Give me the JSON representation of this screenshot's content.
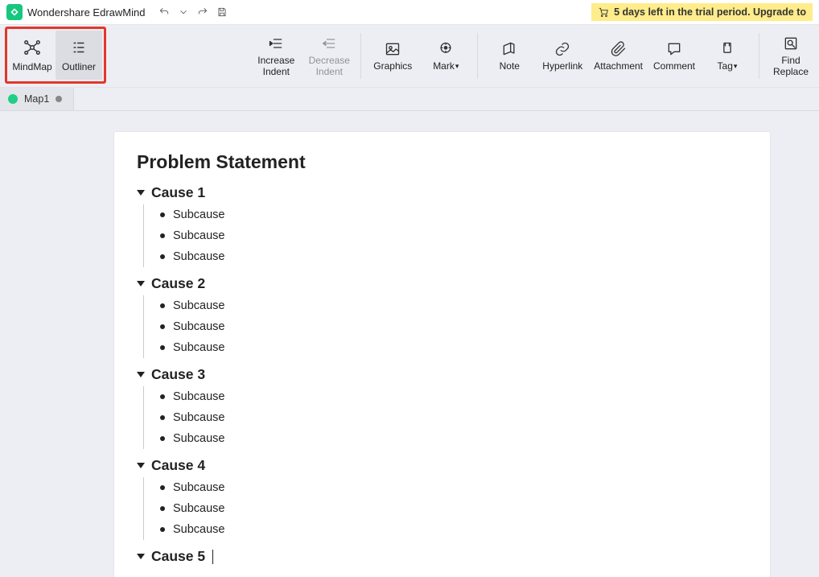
{
  "app": {
    "title": "Wondershare EdrawMind",
    "trial_notice": "5 days left in the trial period. Upgrade to"
  },
  "views": {
    "mindmap": "MindMap",
    "outliner": "Outliner"
  },
  "ribbon": {
    "increase_indent": "Increase\nIndent",
    "decrease_indent": "Decrease\nIndent",
    "graphics": "Graphics",
    "mark": "Mark",
    "note": "Note",
    "hyperlink": "Hyperlink",
    "attachment": "Attachment",
    "comment": "Comment",
    "tag": "Tag",
    "find_replace": "Find\nReplace"
  },
  "tab": {
    "name": "Map1"
  },
  "outline": {
    "root": "Problem Statement",
    "causes": [
      {
        "title": "Cause 1",
        "subs": [
          "Subcause",
          "Subcause",
          "Subcause"
        ]
      },
      {
        "title": "Cause 2",
        "subs": [
          "Subcause",
          "Subcause",
          "Subcause"
        ]
      },
      {
        "title": "Cause 3",
        "subs": [
          "Subcause",
          "Subcause",
          "Subcause"
        ]
      },
      {
        "title": "Cause 4",
        "subs": [
          "Subcause",
          "Subcause",
          "Subcause"
        ]
      },
      {
        "title": "Cause 5",
        "subs": []
      }
    ]
  }
}
